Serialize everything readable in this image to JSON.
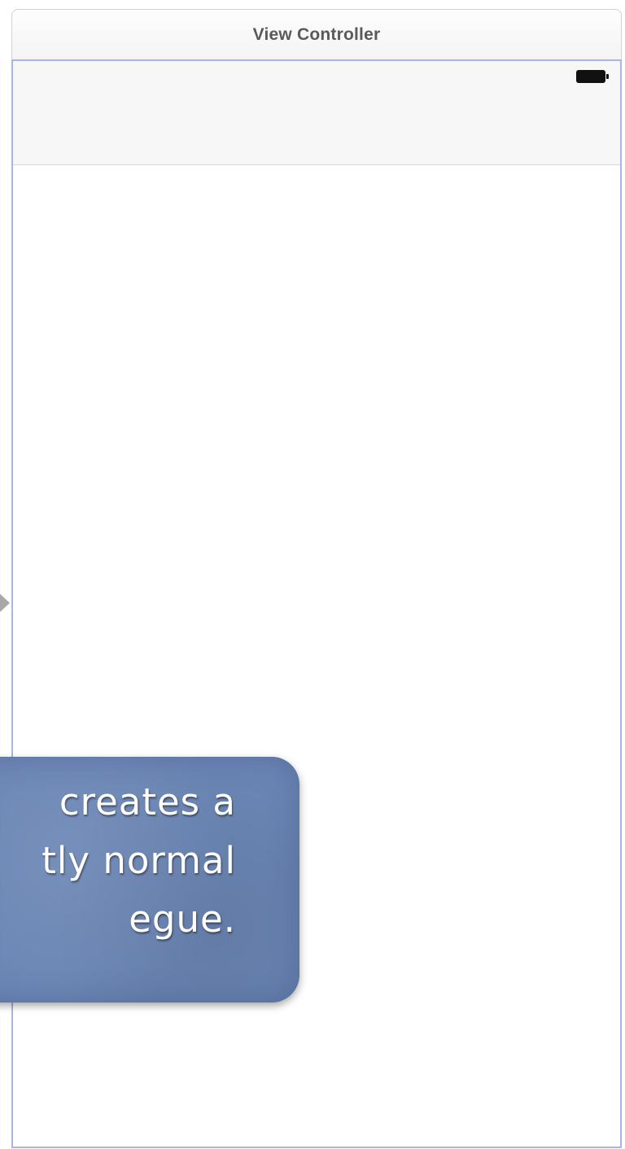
{
  "scene": {
    "title": "View Controller"
  },
  "status_bar": {
    "battery_icon": "battery-full-icon"
  },
  "entry_point": {
    "icon": "arrow-right-icon"
  },
  "callout": {
    "lines": [
      "creates a",
      "tly normal",
      "egue."
    ],
    "background_color": "#6b86b5",
    "text_color": "#ffffff"
  },
  "colors": {
    "canvas_border": "#a9b6e4",
    "status_bar_bg": "#f7f7f7",
    "title_text": "#5a5a5a"
  }
}
